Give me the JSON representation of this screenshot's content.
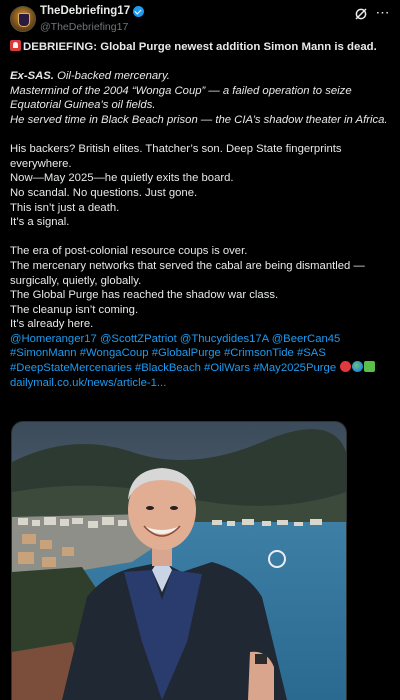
{
  "post": {
    "display_name": "TheDebriefing17",
    "handle": "@TheDebriefing17",
    "headline": "DEBRIEFING: Global Purge newest addition Simon Mann is dead.",
    "bold_prefix": "Ex-SAS.",
    "italic_lines": [
      " Oil-backed mercenary.",
      "Mastermind of the 2004 “Wonga Coup” — a failed operation to seize",
      "Equatorial Guinea’s oil fields.",
      "He served time in Black Beach prison — the CIA’s shadow theater in Africa."
    ],
    "para2": [
      "His backers? British elites. Thatcher’s son. Deep State fingerprints",
      "everywhere.",
      "Now—May 2025—he quietly exits the board.",
      "No scandal. No questions. Just gone.",
      "This isn’t just a death.",
      "It’s a signal."
    ],
    "para3": [
      "The era of post-colonial resource coups is over.",
      "The mercenary networks that served the cabal are being dismantled —",
      "surgically, quietly, globally.",
      "The Global Purge has reached the shadow war class.",
      "The cleanup isn’t coming.",
      "It’s already here."
    ],
    "mentions_line": "@Homeranger17 @ScottZPatriot @Thucydides17A @BeerCan45",
    "hashtags_line1": "#SimonMann #WongaCoup #GlobalPurge #CrimsonTide #SAS",
    "hashtags_line2": "#DeepStateMercenaries #BlackBeach #OilWars #May2025Purge",
    "link_text": "dailymail.co.uk/news/article-1..."
  },
  "icons": {
    "avatar": "avatar-badge",
    "verified": "verified-badge-icon",
    "grok": "grok-icon",
    "more": "more-options-icon",
    "headline_emoji": "police-siren-icon",
    "trailing_emojis": [
      "red-circle-icon",
      "globe-icon",
      "puzzle-piece-icon"
    ]
  },
  "colors": {
    "background": "#000000",
    "text": "#e7e9ea",
    "secondary": "#71767b",
    "link": "#1d9bf0"
  }
}
